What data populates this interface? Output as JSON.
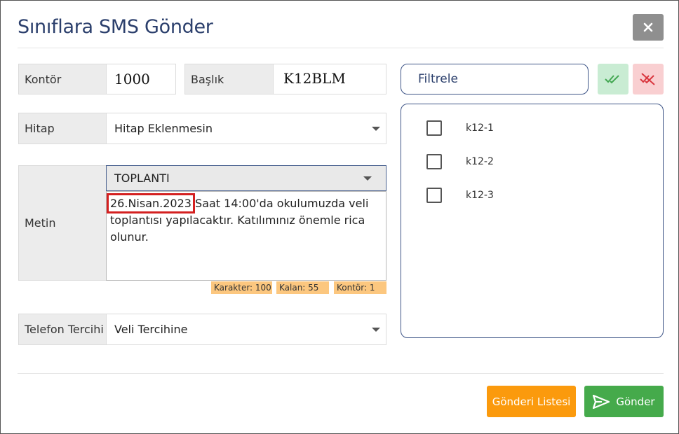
{
  "dialog": {
    "title": "Sınıflara SMS Gönder"
  },
  "form": {
    "kontor": {
      "label": "Kontör",
      "value": "1000"
    },
    "baslik": {
      "label": "Başlık",
      "value": "K12BLM"
    },
    "hitap": {
      "label": "Hitap",
      "value": "Hitap Eklenmesin"
    },
    "metin": {
      "label": "Metin",
      "template": "TOPLANTI",
      "date_text": "26.Nisan.2023",
      "body_text": " Saat 14:00'da okulumuzda veli toplantısı yapılacaktır. Katılımınız önemle rica olunur."
    },
    "counters": {
      "karakter": "Karakter: 100",
      "kalan": "Kalan: 55",
      "kontor": "Kontör: 1"
    },
    "telefon": {
      "label": "Telefon Tercihi",
      "value": "Veli Tercihine"
    }
  },
  "filter": {
    "placeholder": "Filtrele"
  },
  "classes": [
    {
      "label": "k12-1",
      "checked": false
    },
    {
      "label": "k12-2",
      "checked": false
    },
    {
      "label": "k12-3",
      "checked": false
    }
  ],
  "buttons": {
    "list": "Gönderi Listesi",
    "send": "Gönder"
  },
  "colors": {
    "title": "#2b3f6c",
    "accent_border": "#3e5587",
    "close_bg": "#8f8f8f",
    "check_all_bg": "#c9ecd3",
    "uncheck_all_bg": "#f9cfd1",
    "counter_bg": "#fcc77f",
    "list_button_bg": "#fb9a0d",
    "send_button_bg": "#45aa4b",
    "highlight_border": "#d42020"
  },
  "icons": {
    "close": "close-icon",
    "check_all": "double-check-icon",
    "uncheck_all": "double-check-off-icon",
    "send": "send-icon",
    "dropdown": "caret-down-icon"
  }
}
